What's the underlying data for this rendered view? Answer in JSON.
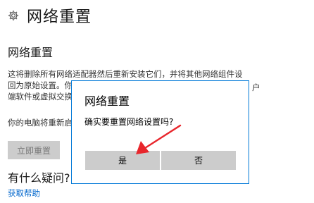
{
  "header": {
    "title": "网络重置",
    "icon": "gear-icon"
  },
  "section": {
    "title": "网络重置",
    "description_lines": [
      "这将删除所有网络适配器然后重新安装它们，并将其他网络组件设",
      "回为原始设置。你",
      "端软件或虚拟交换"
    ],
    "right_peek": "户",
    "notice": "你的电脑将重新启动",
    "reset_button": "立即重置"
  },
  "help": {
    "heading": "有什么疑问?",
    "link": "获取帮助"
  },
  "dialog": {
    "title": "网络重置",
    "message": "确实要重置网络设置吗?",
    "yes_button": "是",
    "no_button": "否"
  },
  "colors": {
    "dialog_border": "#0078d7",
    "button_bg": "#cccccc",
    "link": "#0066cc",
    "annotation_arrow": "#e8262c"
  }
}
